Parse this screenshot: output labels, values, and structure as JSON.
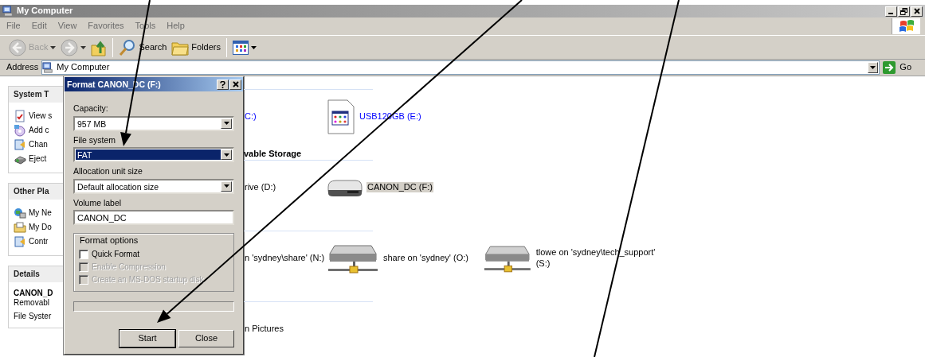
{
  "window": {
    "title": "My Computer"
  },
  "menu": [
    "File",
    "Edit",
    "View",
    "Favorites",
    "Tools",
    "Help"
  ],
  "toolbar": [
    {
      "kind": "back",
      "label": "Back",
      "disabled": true
    },
    {
      "kind": "forward",
      "disabled": true
    },
    {
      "kind": "up",
      "disabled": false
    },
    {
      "kind": "search",
      "label": "Search",
      "disabled": false
    },
    {
      "kind": "folders",
      "label": "Folders",
      "disabled": false
    },
    {
      "kind": "views",
      "disabled": false
    }
  ],
  "address": {
    "label": "Address",
    "value": "My Computer",
    "go": "Go"
  },
  "task_panes": [
    {
      "title": "System T",
      "items": [
        {
          "kind": "view",
          "label": "View s"
        },
        {
          "kind": "add",
          "label": "Add c"
        },
        {
          "kind": "change",
          "label": "Chan"
        },
        {
          "kind": "eject",
          "label": "Eject"
        }
      ]
    },
    {
      "title": "Other Pla",
      "items": [
        {
          "kind": "network",
          "label": "My Ne"
        },
        {
          "kind": "documents",
          "label": "My Do"
        },
        {
          "kind": "control",
          "label": "Contr"
        }
      ]
    },
    {
      "title": "Details",
      "name": "CANON_D",
      "lines": [
        "Removabl",
        "File Syster"
      ]
    }
  ],
  "dialog": {
    "title": "Format CANON_DC (F:)",
    "fields": [
      {
        "kind": "select",
        "label": "Capacity:",
        "value": "957 MB",
        "selected": false
      },
      {
        "kind": "select",
        "label": "File system",
        "value": "FAT",
        "selected": true
      },
      {
        "kind": "select",
        "label": "Allocation unit size",
        "value": "Default allocation size",
        "selected": false
      },
      {
        "kind": "text",
        "label": "Volume label",
        "value": "CANON_DC",
        "selected": false
      }
    ],
    "options_title": "Format options",
    "options": [
      {
        "label": "Quick Format",
        "checked": false,
        "disabled": false
      },
      {
        "label": "Enable Compression",
        "checked": false,
        "disabled": true
      },
      {
        "label": "Create an MS-DOS startup disk",
        "checked": false,
        "disabled": true
      }
    ],
    "buttons": [
      {
        "label": "Start",
        "default": true
      },
      {
        "label": "Close",
        "default": false
      }
    ]
  },
  "sections": [
    {
      "items": [
        {
          "kind": "text",
          "label": "C:)",
          "link": true,
          "selected": false
        },
        {
          "kind": "usb",
          "label": "USB120GB (E:)",
          "link": true,
          "selected": false
        }
      ]
    },
    {
      "header": "vable Storage",
      "items": [
        {
          "kind": "text",
          "label": "rive (D:)",
          "link": false,
          "selected": false
        },
        {
          "kind": "drive",
          "label": "CANON_DC (F:)",
          "link": false,
          "selected": true
        }
      ]
    },
    {
      "items": [
        {
          "kind": "text",
          "label": "n 'sydney\\share' (N:)",
          "link": false,
          "selected": false
        },
        {
          "kind": "network",
          "label": "share on 'sydney' (O:)",
          "link": false,
          "selected": false
        },
        {
          "kind": "network",
          "label": "tlowe on 'sydney\\tech_support' (S:)",
          "link": false,
          "selected": false
        }
      ]
    },
    {
      "items": [
        {
          "kind": "text",
          "label": "n Pictures",
          "link": false,
          "selected": false
        }
      ]
    }
  ],
  "annotations": [
    {
      "kind": "arrow"
    },
    {
      "kind": "arrow"
    },
    {
      "kind": "line"
    }
  ]
}
